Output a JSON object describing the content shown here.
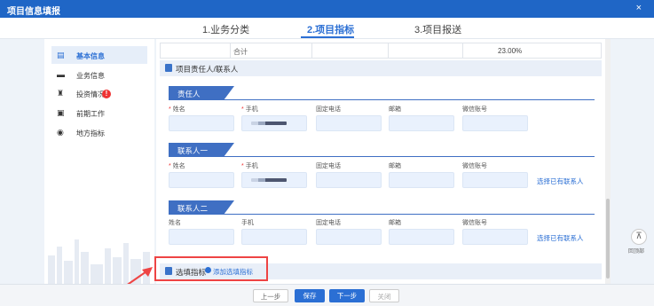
{
  "title": "项目信息填报",
  "close": "×",
  "steps": [
    "1.业务分类",
    "2.项目指标",
    "3.项目报送"
  ],
  "sidebar": {
    "items": [
      {
        "label": "基本信息",
        "icon": "doc-icon"
      },
      {
        "label": "业务信息",
        "icon": "card-icon"
      },
      {
        "label": "投资情况",
        "icon": "money-bag-icon"
      },
      {
        "label": "前期工作",
        "icon": "briefcase-icon"
      },
      {
        "label": "地方指标",
        "icon": "compass-icon"
      }
    ],
    "warning_badge": "!"
  },
  "table": {
    "sum_label": "合计",
    "percent": "23.00%"
  },
  "section_contacts": {
    "title": "项目责任人/联系人"
  },
  "person_blocks": [
    {
      "tag": "责任人",
      "fields": [
        "姓名",
        "手机",
        "固定电话",
        "邮箱",
        "微信账号"
      ],
      "required": [
        true,
        true,
        false,
        false,
        false
      ],
      "link": ""
    },
    {
      "tag": "联系人一",
      "fields": [
        "姓名",
        "手机",
        "固定电话",
        "邮箱",
        "微信账号"
      ],
      "required": [
        true,
        true,
        false,
        false,
        false
      ],
      "link": "选择已有联系人"
    },
    {
      "tag": "联系人二",
      "fields": [
        "姓名",
        "手机",
        "固定电话",
        "邮箱",
        "微信账号"
      ],
      "required": [
        false,
        false,
        false,
        false,
        false
      ],
      "link": "选择已有联系人"
    }
  ],
  "optional_section": {
    "title": "选填指标",
    "add_label": "添加选填指标"
  },
  "footer": {
    "prev": "上一步",
    "save": "保存",
    "next": "下一步",
    "close": "关闭"
  },
  "back_to_top": {
    "icon": "arrow-up-icon",
    "label": "回顶部"
  }
}
